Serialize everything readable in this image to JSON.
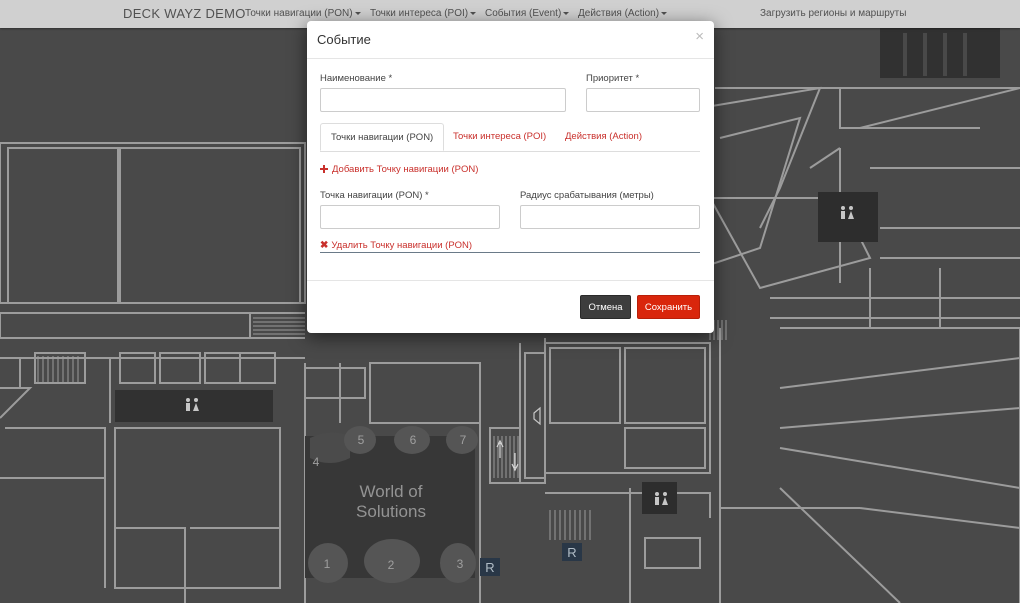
{
  "navbar": {
    "brand": "DECK WAYZ DEMO",
    "menus": [
      {
        "label": "Точки навигации (PON)"
      },
      {
        "label": "Точки интереса (POI)"
      },
      {
        "label": "События (Event)"
      },
      {
        "label": "Действия (Action)"
      }
    ],
    "upload_label": "Загрузить регионы и маршруты"
  },
  "map": {
    "area_title_line1": "World of",
    "area_title_line2": "Solutions",
    "room_numbers": [
      "1",
      "2",
      "3",
      "4",
      "5",
      "6",
      "7"
    ],
    "elevator_labels": [
      "R",
      "R"
    ],
    "restroom_icon": "restroom-icon",
    "stairs_icon": "stairs-icon"
  },
  "modal": {
    "title": "Событие",
    "close_symbol": "×",
    "name_label": "Наименование *",
    "name_value": "",
    "priority_label": "Приоритет *",
    "priority_value": "",
    "tabs": [
      {
        "label": "Точки навигации (PON)",
        "active": true
      },
      {
        "label": "Точки интереса (POI)",
        "active": false
      },
      {
        "label": "Действия (Action)",
        "active": false
      }
    ],
    "add_pon_label": "Добавить Точку навигации (PON)",
    "pon_label": "Точка навигации (PON) *",
    "pon_value": "",
    "radius_label": "Радиус срабатывания (метры)",
    "radius_value": "",
    "remove_pon_label": "Удалить Точку навигации (PON)",
    "cancel_label": "Отмена",
    "save_label": "Сохранить"
  },
  "colors": {
    "accent": "#d9260c",
    "link": "#c9302c",
    "map_bg": "#4d4d4d",
    "map_lines": "#a6a6a6",
    "navbar_bg": "#d9d9d9"
  }
}
